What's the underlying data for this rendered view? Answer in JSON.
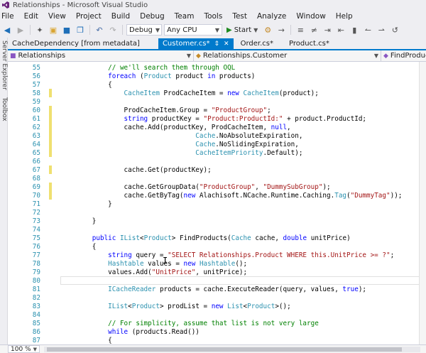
{
  "window": {
    "title": "Relationships - Microsoft Visual Studio"
  },
  "menu": [
    "File",
    "Edit",
    "View",
    "Project",
    "Build",
    "Debug",
    "Team",
    "Tools",
    "Test",
    "Analyze",
    "Window",
    "Help"
  ],
  "toolbar": {
    "configuration": "Debug",
    "platform": "Any CPU",
    "start_label": "Start"
  },
  "side_panels": [
    "Server Explorer",
    "Toolbox"
  ],
  "tabs": [
    {
      "label": "CacheDependency [from metadata]",
      "active": false
    },
    {
      "label": "Customer.cs*",
      "active": true
    },
    {
      "label": "Order.cs*",
      "active": false
    },
    {
      "label": "Product.cs*",
      "active": false
    }
  ],
  "nav": {
    "project": "Relationships",
    "type": "Relationships.Customer",
    "member": "FindProducts(C"
  },
  "code_lines": [
    {
      "n": "55",
      "mark": false,
      "tokens": [
        [
          "cm",
          "            // we'll search them through OQL"
        ]
      ]
    },
    {
      "n": "56",
      "mark": false,
      "tokens": [
        [
          "kw",
          "            foreach"
        ],
        [
          "code",
          " ("
        ],
        [
          "ty",
          "Product"
        ],
        [
          "code",
          " product "
        ],
        [
          "kw",
          "in"
        ],
        [
          "code",
          " products)"
        ]
      ]
    },
    {
      "n": "57",
      "mark": false,
      "tokens": [
        [
          "code",
          "            {"
        ]
      ]
    },
    {
      "n": "58",
      "mark": true,
      "tokens": [
        [
          "ty",
          "                CacheItem"
        ],
        [
          "code",
          " ProdCacheItem = "
        ],
        [
          "kw",
          "new"
        ],
        [
          "code",
          " "
        ],
        [
          "ty",
          "CacheItem"
        ],
        [
          "code",
          "(product);"
        ]
      ]
    },
    {
      "n": "59",
      "mark": false,
      "tokens": [
        [
          "code",
          ""
        ]
      ]
    },
    {
      "n": "60",
      "mark": true,
      "tokens": [
        [
          "code",
          "                ProdCacheItem.Group = "
        ],
        [
          "str",
          "\"ProductGroup\""
        ],
        [
          "code",
          ";"
        ]
      ]
    },
    {
      "n": "61",
      "mark": true,
      "tokens": [
        [
          "kw",
          "                string"
        ],
        [
          "code",
          " productKey = "
        ],
        [
          "str",
          "\"Product:ProductId:\""
        ],
        [
          "code",
          " + product.ProductId;"
        ]
      ]
    },
    {
      "n": "62",
      "mark": true,
      "tokens": [
        [
          "code",
          "                cache.Add(productKey, ProdCacheItem, "
        ],
        [
          "kw",
          "null"
        ],
        [
          "code",
          ","
        ]
      ]
    },
    {
      "n": "63",
      "mark": true,
      "tokens": [
        [
          "ty",
          "                                  Cache"
        ],
        [
          "code",
          ".NoAbsoluteExpiration,"
        ]
      ]
    },
    {
      "n": "64",
      "mark": true,
      "tokens": [
        [
          "ty",
          "                                  Cache"
        ],
        [
          "code",
          ".NoSlidingExpiration,"
        ]
      ]
    },
    {
      "n": "65",
      "mark": true,
      "tokens": [
        [
          "ty",
          "                                  CacheItemPriority"
        ],
        [
          "code",
          ".Default);"
        ]
      ]
    },
    {
      "n": "66",
      "mark": false,
      "tokens": [
        [
          "code",
          ""
        ]
      ]
    },
    {
      "n": "67",
      "mark": true,
      "tokens": [
        [
          "code",
          "                cache.Get(productKey);"
        ]
      ]
    },
    {
      "n": "68",
      "mark": false,
      "tokens": [
        [
          "code",
          ""
        ]
      ]
    },
    {
      "n": "69",
      "mark": true,
      "tokens": [
        [
          "code",
          "                cache.GetGroupData("
        ],
        [
          "str",
          "\"ProductGroup\""
        ],
        [
          "code",
          ", "
        ],
        [
          "str",
          "\"DummySubGroup\""
        ],
        [
          "code",
          ");"
        ]
      ]
    },
    {
      "n": "70",
      "mark": true,
      "tokens": [
        [
          "code",
          "                cache.GetByTag("
        ],
        [
          "kw",
          "new"
        ],
        [
          "code",
          " Alachisoft.NCache.Runtime.Caching."
        ],
        [
          "ty",
          "Tag"
        ],
        [
          "code",
          "("
        ],
        [
          "str",
          "\"DummyTag\""
        ],
        [
          "code",
          "));"
        ]
      ]
    },
    {
      "n": "71",
      "mark": false,
      "tokens": [
        [
          "code",
          "            }"
        ]
      ]
    },
    {
      "n": "72",
      "mark": false,
      "tokens": [
        [
          "code",
          ""
        ]
      ]
    },
    {
      "n": "73",
      "mark": false,
      "tokens": [
        [
          "code",
          "        }"
        ]
      ]
    },
    {
      "n": "74",
      "mark": false,
      "tokens": [
        [
          "code",
          ""
        ]
      ]
    },
    {
      "n": "75",
      "mark": false,
      "tokens": [
        [
          "kw",
          "        public"
        ],
        [
          "code",
          " "
        ],
        [
          "ty",
          "IList"
        ],
        [
          "code",
          "<"
        ],
        [
          "ty",
          "Product"
        ],
        [
          "code",
          "> FindProducts("
        ],
        [
          "ty",
          "Cache"
        ],
        [
          "code",
          " cache, "
        ],
        [
          "kw",
          "double"
        ],
        [
          "code",
          " unitPrice)"
        ]
      ]
    },
    {
      "n": "76",
      "mark": false,
      "tokens": [
        [
          "code",
          "        {"
        ]
      ]
    },
    {
      "n": "77",
      "mark": false,
      "tokens": [
        [
          "kw",
          "            string"
        ],
        [
          "code",
          " query = "
        ],
        [
          "str",
          "\"SELECT Relationships.Product WHERE this.UnitPrice >= ?\""
        ],
        [
          "code",
          ";"
        ]
      ]
    },
    {
      "n": "78",
      "mark": false,
      "tokens": [
        [
          "ty",
          "            Hashtable"
        ],
        [
          "code",
          " values = "
        ],
        [
          "kw",
          "new"
        ],
        [
          "code",
          " "
        ],
        [
          "ty",
          "Hashtable"
        ],
        [
          "code",
          "();"
        ]
      ]
    },
    {
      "n": "79",
      "mark": false,
      "tokens": [
        [
          "code",
          "            values.Add("
        ],
        [
          "str",
          "\"UnitPrice\""
        ],
        [
          "code",
          ", unitPrice);"
        ]
      ]
    },
    {
      "n": "80",
      "mark": false,
      "tokens": [
        [
          "code",
          ""
        ]
      ]
    },
    {
      "n": "81",
      "mark": false,
      "tokens": [
        [
          "ty",
          "            ICacheReader"
        ],
        [
          "code",
          " products = cache.ExecuteReader(query, values, "
        ],
        [
          "kw",
          "true"
        ],
        [
          "code",
          ");"
        ]
      ]
    },
    {
      "n": "82",
      "mark": false,
      "tokens": [
        [
          "code",
          ""
        ]
      ]
    },
    {
      "n": "83",
      "mark": false,
      "tokens": [
        [
          "ty",
          "            IList"
        ],
        [
          "code",
          "<"
        ],
        [
          "ty",
          "Product"
        ],
        [
          "code",
          "> prodList = "
        ],
        [
          "kw",
          "new"
        ],
        [
          "code",
          " "
        ],
        [
          "ty",
          "List"
        ],
        [
          "code",
          "<"
        ],
        [
          "ty",
          "Product"
        ],
        [
          "code",
          ">();"
        ]
      ]
    },
    {
      "n": "84",
      "mark": false,
      "tokens": [
        [
          "code",
          ""
        ]
      ]
    },
    {
      "n": "85",
      "mark": false,
      "tokens": [
        [
          "cm",
          "            // For simplicity, assume that list is not very large"
        ]
      ]
    },
    {
      "n": "86",
      "mark": false,
      "tokens": [
        [
          "kw",
          "            while"
        ],
        [
          "code",
          " (products.Read())"
        ]
      ]
    },
    {
      "n": "87",
      "mark": false,
      "tokens": [
        [
          "code",
          "            {"
        ]
      ]
    }
  ],
  "status": {
    "zoom": "100 %"
  }
}
